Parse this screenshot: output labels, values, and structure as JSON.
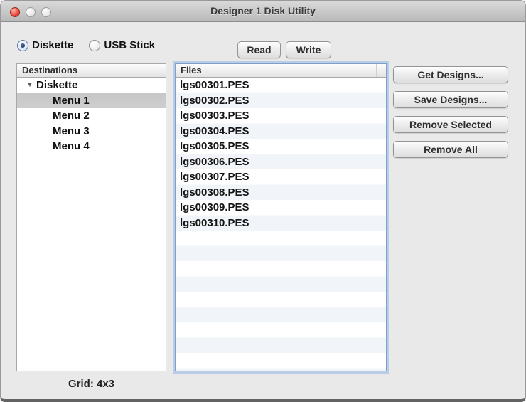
{
  "window": {
    "title": "Designer 1 Disk Utility",
    "traffic_lights": [
      "close",
      "minimize",
      "zoom"
    ]
  },
  "source_selector": {
    "options": [
      {
        "label": "Diskette",
        "selected": true
      },
      {
        "label": "USB Stick",
        "selected": false
      }
    ]
  },
  "toolbar": {
    "read_label": "Read",
    "write_label": "Write"
  },
  "destinations": {
    "header": "Destinations",
    "root_label": "Diskette",
    "root_expanded": true,
    "items": [
      {
        "label": "Menu 1",
        "selected": true
      },
      {
        "label": "Menu 2",
        "selected": false
      },
      {
        "label": "Menu 3",
        "selected": false
      },
      {
        "label": "Menu 4",
        "selected": false
      }
    ]
  },
  "files": {
    "header": "Files",
    "items": [
      "lgs00301.PES",
      "lgs00302.PES",
      "lgs00303.PES",
      "lgs00304.PES",
      "lgs00305.PES",
      "lgs00306.PES",
      "lgs00307.PES",
      "lgs00308.PES",
      "lgs00309.PES",
      "lgs00310.PES"
    ]
  },
  "actions": [
    {
      "id": "get-designs",
      "label": "Get Designs..."
    },
    {
      "id": "save-designs",
      "label": "Save Designs..."
    },
    {
      "id": "remove-selected",
      "label": "Remove Selected"
    },
    {
      "id": "remove-all",
      "label": "Remove All"
    }
  ],
  "status": {
    "grid_label": "Grid: 4x3"
  },
  "colors": {
    "window_bg": "#e9e9e9",
    "titlebar_top": "#dadada",
    "titlebar_bottom": "#b9b9b9",
    "close_light": "#e8463a",
    "row_stripe": "#f1f5fa",
    "selection_gray": "#c9c9c9",
    "focus_ring": "#b9cde9",
    "focus_border": "#7f9fc6"
  }
}
